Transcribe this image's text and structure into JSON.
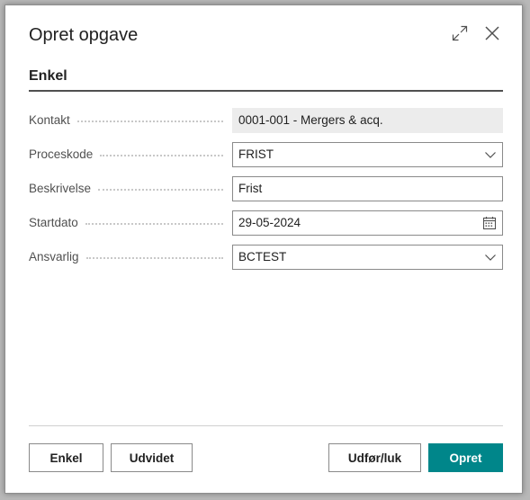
{
  "dialog": {
    "title": "Opret opgave",
    "expand_icon": "expand-icon",
    "close_icon": "close-icon"
  },
  "section": {
    "title": "Enkel"
  },
  "fields": [
    {
      "label": "Kontakt",
      "value": "0001-001 - Mergers & acq.",
      "type": "readonly"
    },
    {
      "label": "Proceskode",
      "value": "FRIST",
      "type": "dropdown"
    },
    {
      "label": "Beskrivelse",
      "value": "Frist",
      "type": "text"
    },
    {
      "label": "Startdato",
      "value": "29-05-2024",
      "type": "date"
    },
    {
      "label": "Ansvarlig",
      "value": "BCTEST",
      "type": "dropdown"
    }
  ],
  "buttons": {
    "enkel": "Enkel",
    "udvidet": "Udvidet",
    "udfor_luk": "Udfør/luk",
    "opret": "Opret"
  },
  "colors": {
    "primary": "#00868a",
    "readonly_bg": "#ececec"
  }
}
